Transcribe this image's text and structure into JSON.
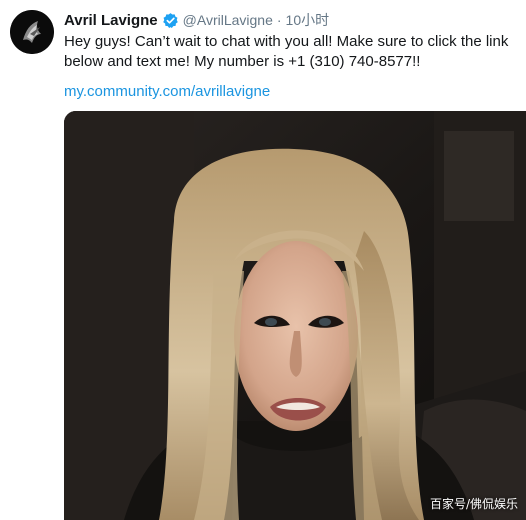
{
  "tweet": {
    "author_name": "Avril Lavigne",
    "handle": "@AvrilLavigne",
    "separator": "·",
    "time": "10小时",
    "text_line1": "Hey guys! Can’t wait to chat with you all! Make sure to click the link",
    "text_line2": "below and text me! My number is +1 (310) 740-8577!!",
    "link": "my.community.com/avrillavigne"
  },
  "media": {
    "watermark": "百家号/佛侃娱乐"
  },
  "icons": {
    "verified": "verified-badge-icon",
    "avatar": "avatar"
  },
  "colors": {
    "name": "#14171a",
    "muted": "#657786",
    "link": "#1b95e0",
    "verified": "#1da1f2"
  }
}
